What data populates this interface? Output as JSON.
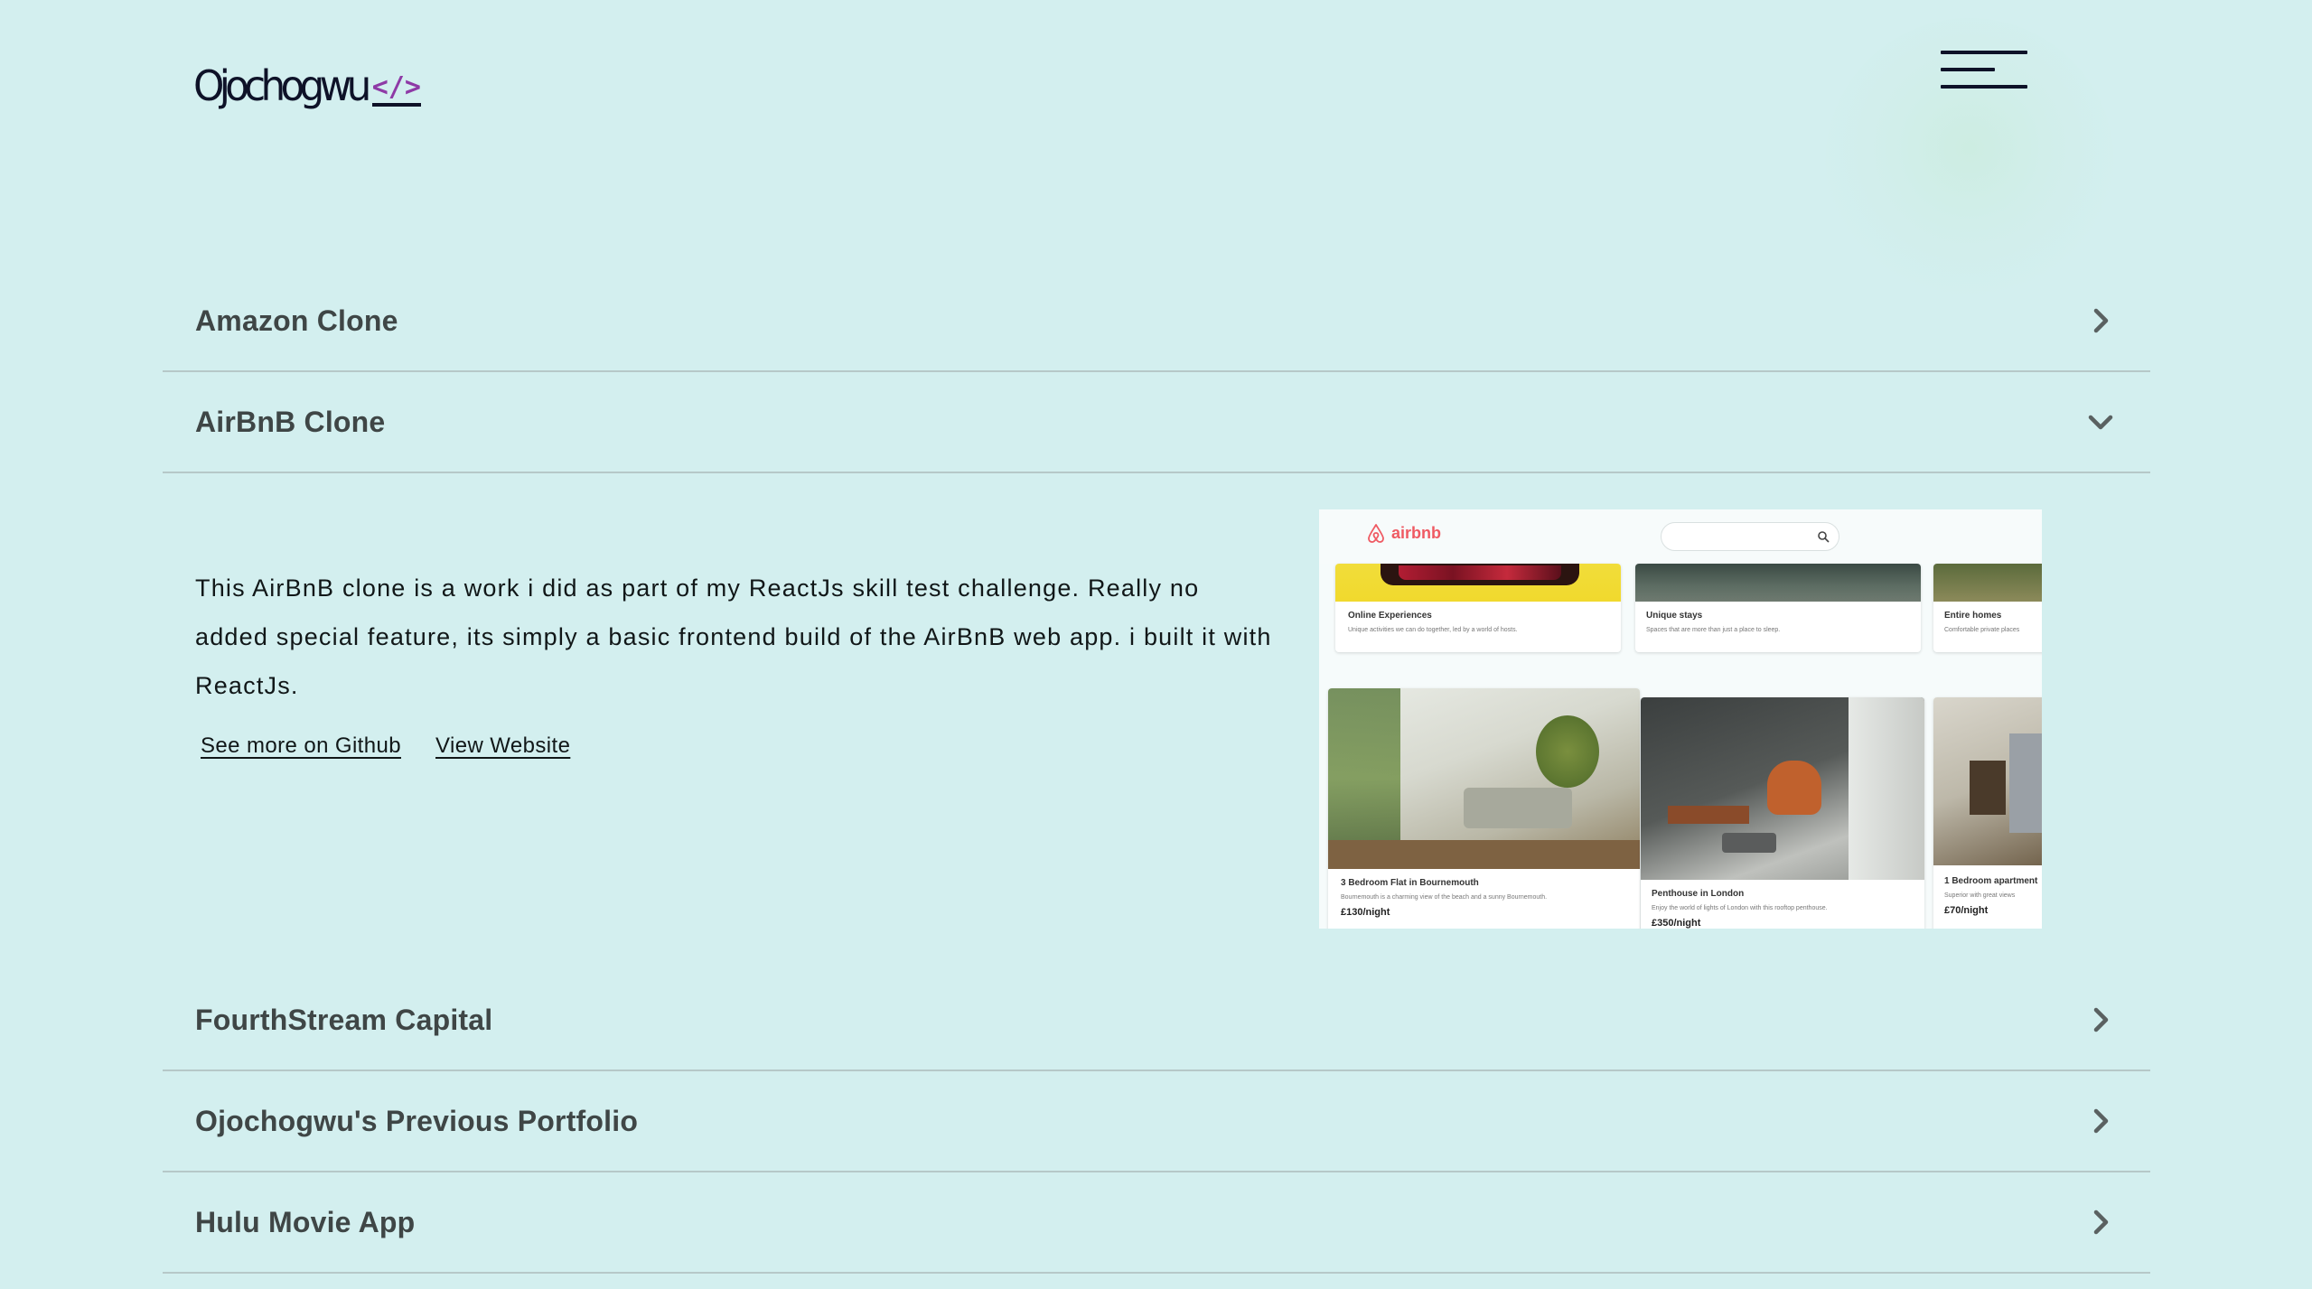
{
  "header": {
    "logo_name": "Ojochogwu",
    "logo_code": "</>",
    "menu_icon": "hamburger-menu-icon"
  },
  "projects": [
    {
      "title": "Amazon Clone",
      "expanded": false,
      "icon": "chevron-right-icon"
    },
    {
      "title": "AirBnB Clone",
      "expanded": true,
      "icon": "chevron-down-icon",
      "description": "This AirBnB clone is a work i did as part of my ReactJs skill test challenge. Really no added special feature, its simply a basic frontend build of the AirBnB web app. i built it with ReactJs.",
      "github_link": "See more on Github",
      "website_link": "View Website",
      "preview": {
        "brand": "airbnb",
        "cards_top": [
          {
            "title": "Online Experiences",
            "subtitle": "Unique activities we can do together, led by a world of hosts."
          },
          {
            "title": "Unique stays",
            "subtitle": "Spaces that are more than just a place to sleep."
          },
          {
            "title": "Entire homes",
            "subtitle": "Comfortable private places"
          }
        ],
        "cards_bottom": [
          {
            "title": "3 Bedroom Flat in Bournemouth",
            "subtitle": "Bournemouth is a charming view of the beach and a sunny Bournemouth.",
            "price": "£130/night"
          },
          {
            "title": "Penthouse in London",
            "subtitle": "Enjoy the world of lights of London with this rooftop penthouse.",
            "price": "£350/night"
          },
          {
            "title": "1 Bedroom apartment",
            "subtitle": "Superior with great views",
            "price": "£70/night"
          }
        ]
      }
    },
    {
      "title": "FourthStream Capital",
      "expanded": false,
      "icon": "chevron-right-icon"
    },
    {
      "title": "Ojochogwu's Previous Portfolio",
      "expanded": false,
      "icon": "chevron-right-icon"
    },
    {
      "title": "Hulu Movie App",
      "expanded": false,
      "icon": "chevron-right-icon"
    }
  ],
  "colors": {
    "background": "#d3efef",
    "text": "#3f4646",
    "logo": "#0e1228",
    "logo_accent": "#8e3aa6",
    "divider": "#b6c8c8",
    "airbnb_brand": "#ef5a63"
  }
}
